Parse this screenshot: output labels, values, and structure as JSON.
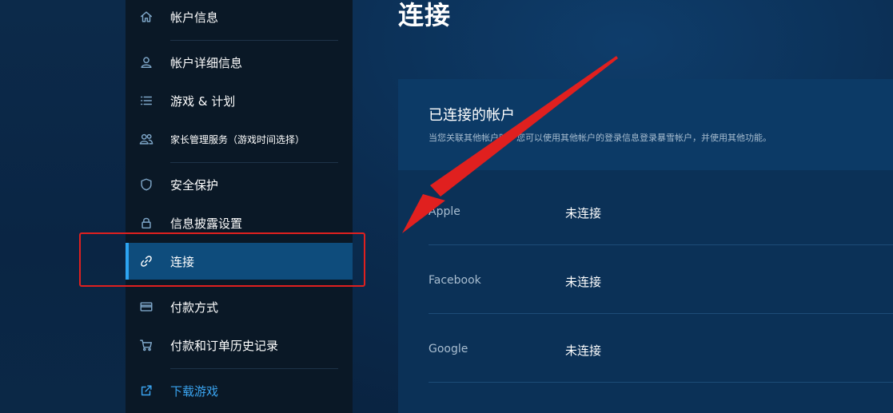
{
  "sidebar": {
    "items": [
      {
        "label": "帐户信息",
        "icon": "home-icon"
      },
      {
        "label": "帐户详细信息",
        "icon": "user-icon"
      },
      {
        "label": "游戏 & 计划",
        "icon": "list-icon"
      },
      {
        "label": "家长管理服务（游戏时间选择）",
        "icon": "users-icon"
      },
      {
        "label": "安全保护",
        "icon": "shield-icon"
      },
      {
        "label": "信息披露设置",
        "icon": "lock-icon"
      },
      {
        "label": "连接",
        "icon": "link-icon",
        "active": true
      },
      {
        "label": "付款方式",
        "icon": "credit-card-icon"
      },
      {
        "label": "付款和订单历史记录",
        "icon": "cart-icon"
      },
      {
        "label": "下载游戏",
        "icon": "external-link-icon"
      }
    ]
  },
  "main": {
    "title": "连接",
    "panel": {
      "title": "已连接的帐户",
      "description": "当您关联其他帐户时，您可以使用其他帐户的登录信息登录暴雪帐户，并使用其他功能。",
      "rows": [
        {
          "name": "Apple",
          "status": "未连接"
        },
        {
          "name": "Facebook",
          "status": "未连接"
        },
        {
          "name": "Google",
          "status": "未连接"
        }
      ]
    }
  },
  "colors": {
    "accent": "#2da4f2",
    "active_bg": "#0e4c7c",
    "annotation": "#e0201f"
  }
}
